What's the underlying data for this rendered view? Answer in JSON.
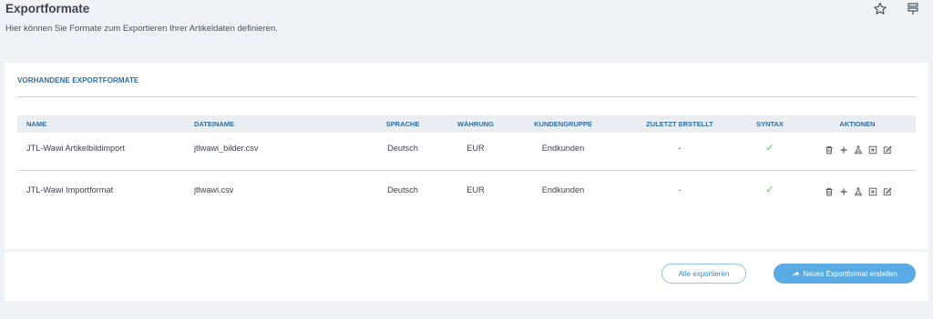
{
  "header": {
    "title": "Exportformate",
    "subtitle": "Hier können Sie Formate zum Exportieren Ihrer Artikeldaten definieren."
  },
  "card": {
    "title": "VORHANDENE EXPORTFORMATE",
    "columns": [
      "NAME",
      "DATEINAME",
      "SPRACHE",
      "WÄHRUNG",
      "KUNDENGRUPPE",
      "ZULETZT ERSTELLT",
      "SYNTAX",
      "AKTIONEN"
    ],
    "rows": [
      {
        "name": "JTL-Wawi Artikelbildimport",
        "file": "jtlwawi_bilder.csv",
        "lang": "Deutsch",
        "currency": "EUR",
        "group": "Endkunden",
        "last": "-",
        "syntax": "✓"
      },
      {
        "name": "JTL-Wawi Importformat",
        "file": "jtlwawi.csv",
        "lang": "Deutsch",
        "currency": "EUR",
        "group": "Endkunden",
        "last": "-",
        "syntax": "✓"
      }
    ],
    "action_icons": [
      "trash-icon",
      "plus-icon",
      "flask-icon",
      "plus-square-icon",
      "edit-icon"
    ]
  },
  "footer": {
    "export_all_label": "Alle exportieren",
    "new_format_label": "Neues Exportformat erstellen"
  },
  "colors": {
    "accent": "#2f6ea3",
    "primary_button": "#5aabe4",
    "check": "#5bbf5e"
  }
}
